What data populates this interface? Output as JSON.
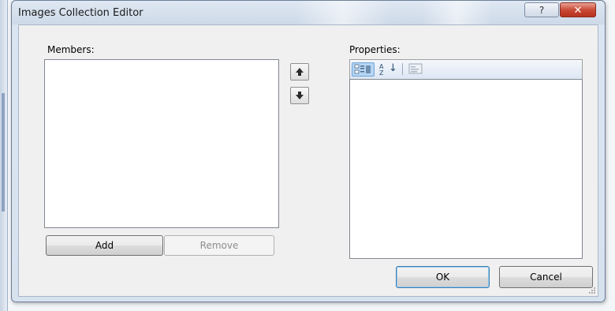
{
  "dialog": {
    "title": "Images Collection Editor",
    "help_glyph": "?",
    "close_glyph": "✕"
  },
  "members": {
    "label": "Members:",
    "add_label": "Add",
    "remove_label": "Remove"
  },
  "properties": {
    "label": "Properties:",
    "sort_glyph": "↓"
  },
  "footer": {
    "ok_label": "OK",
    "cancel_label": "Cancel"
  },
  "colors": {
    "default_button_border": "#3c7fb1",
    "close_button": "#c94a36",
    "toolbar_active": "#b7d6f4"
  }
}
